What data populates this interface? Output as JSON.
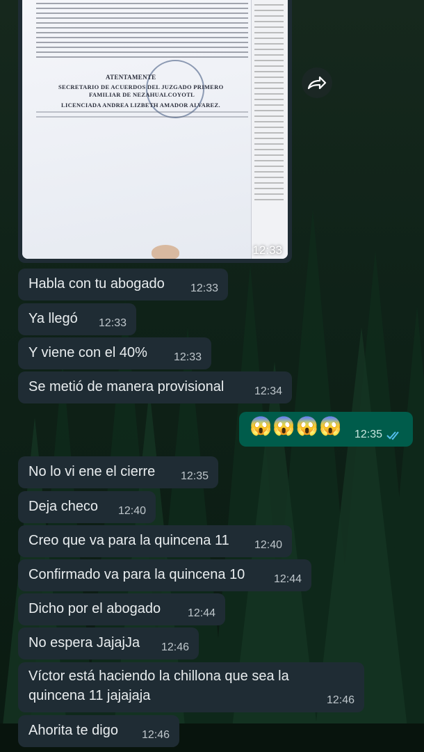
{
  "colors": {
    "incoming_bubble": "#1f2c34",
    "outgoing_bubble": "#005c4b",
    "read_ticks": "#53bdeb",
    "text": "#e9edef"
  },
  "image_message": {
    "time": "12:33",
    "document_heading": "ATENTAMENTE",
    "document_lines": [
      "SECRETARIO DE ACUERDOS DEL JUZGADO PRIMERO",
      "FAMILIAR DE NEZAHUALCOYOTL",
      "LICENCIADA ANDREA LIZBETH AMADOR ALVAREZ."
    ],
    "share_icon": "forward-arrow-icon"
  },
  "messages": [
    {
      "direction": "in",
      "text": "Habla con tu abogado",
      "time": "12:33"
    },
    {
      "direction": "in",
      "text": "Ya llegó",
      "time": "12:33"
    },
    {
      "direction": "in",
      "text": "Y viene con el 40%",
      "time": "12:33"
    },
    {
      "direction": "in",
      "text": "Se metió de manera provisional",
      "time": "12:34"
    },
    {
      "direction": "out",
      "text": "😱😱😱😱",
      "time": "12:35",
      "status": "read"
    },
    {
      "direction": "in",
      "text": "No lo vi ene el cierre",
      "time": "12:35"
    },
    {
      "direction": "in",
      "text": "Deja checo",
      "time": "12:40"
    },
    {
      "direction": "in",
      "text": "Creo que va para la quincena 11",
      "time": "12:40"
    },
    {
      "direction": "in",
      "text": "Confirmado va para la quincena 10",
      "time": "12:44"
    },
    {
      "direction": "in",
      "text": "Dicho por el abogado",
      "time": "12:44"
    },
    {
      "direction": "in",
      "text": "No espera JajajJa",
      "time": "12:46"
    },
    {
      "direction": "in",
      "text": "Víctor está haciendo la chillona que sea la quincena 11 jajajaja",
      "time": "12:46"
    },
    {
      "direction": "in",
      "text": "Ahorita te digo",
      "time": "12:46"
    }
  ]
}
